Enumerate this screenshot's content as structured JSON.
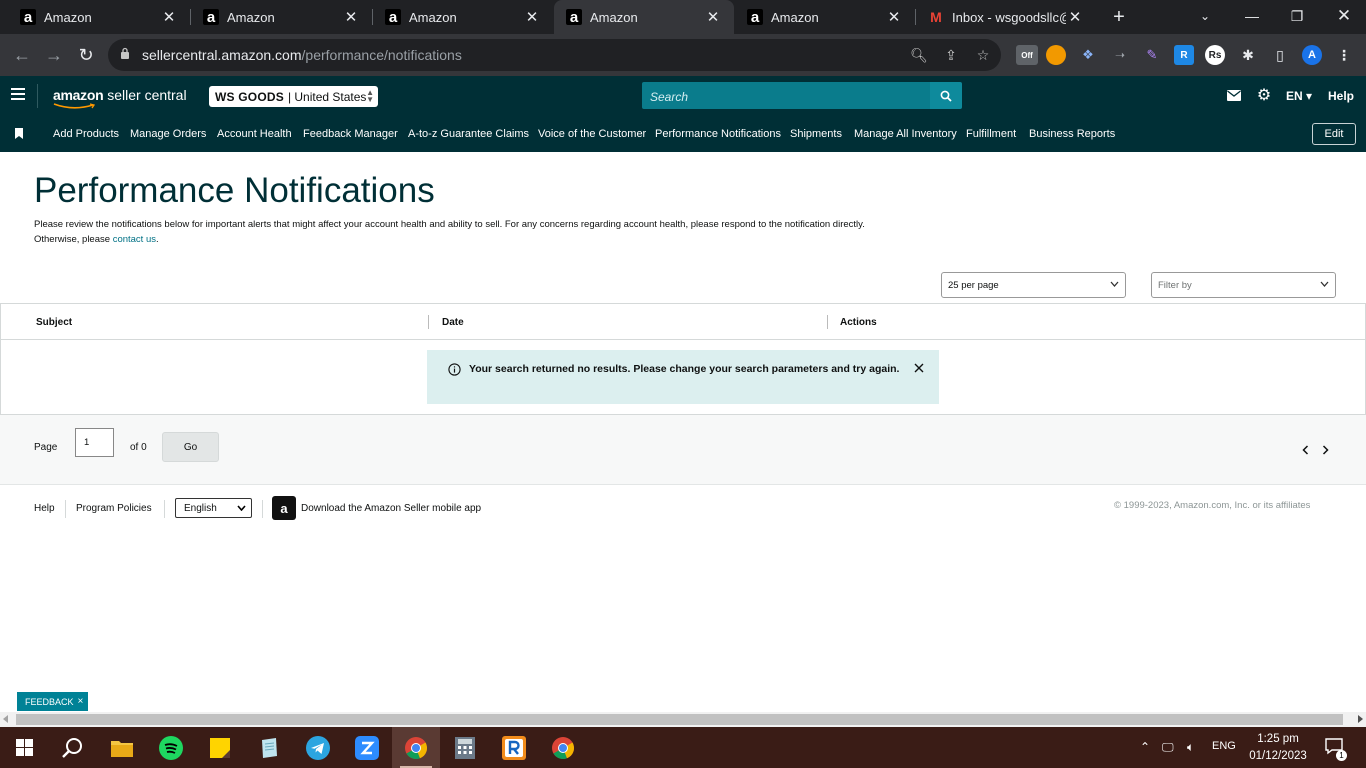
{
  "browser": {
    "tabs": [
      {
        "title": "Amazon",
        "favicon": "amazon-icon"
      },
      {
        "title": "Amazon",
        "favicon": "amazon-icon"
      },
      {
        "title": "Amazon",
        "favicon": "amazon-icon"
      },
      {
        "title": "Amazon",
        "favicon": "amazon-icon",
        "active": true
      },
      {
        "title": "Amazon",
        "favicon": "amazon-icon"
      },
      {
        "title": "Inbox - wsgoodsllc@",
        "favicon": "gmail-icon"
      }
    ],
    "url_host": "sellercentral.amazon.com",
    "url_path": "/performance/notifications",
    "profile_initial": "A",
    "ext_off_label": "Off",
    "ext_rs_label": "Rs",
    "ext_r_label": "R"
  },
  "header": {
    "logo_text_bold": "amazon",
    "logo_text": " seller central",
    "store_name": "WS GOODS",
    "marketplace": "| United States",
    "search_placeholder": "Search",
    "language": "EN",
    "help": "Help"
  },
  "nav": {
    "links": [
      "Add Products",
      "Manage Orders",
      "Account Health",
      "Feedback Manager",
      "A-to-z Guarantee Claims",
      "Voice of the Customer",
      "Performance Notifications",
      "Shipments",
      "Manage All Inventory",
      "Fulfillment",
      "Business Reports"
    ],
    "edit": "Edit"
  },
  "page": {
    "title": "Performance Notifications",
    "intro": "Please review the notifications below for important alerts that might affect your account health and ability to sell. For any concerns regarding account health, please respond to the notification directly. Otherwise, please ",
    "contact_link": "contact us",
    "intro_end": ".",
    "per_page": "25 per page",
    "filter_placeholder": "Filter by",
    "columns": [
      "Subject",
      "Date",
      "Actions"
    ],
    "alert_message": "Your search returned no results. Please change your search parameters and try again.",
    "pager": {
      "page_label": "Page",
      "page_value": "1",
      "of_label": "of 0",
      "go": "Go"
    }
  },
  "footer": {
    "help": "Help",
    "policies": "Program Policies",
    "language": "English",
    "app_text": "Download the Amazon Seller mobile app",
    "copyright": "© 1999-2023, Amazon.com, Inc. or its affiliates",
    "feedback": "FEEDBACK"
  },
  "taskbar": {
    "language": "ENG",
    "time": "1:25 pm",
    "date": "01/12/2023",
    "notification_count": "1"
  }
}
